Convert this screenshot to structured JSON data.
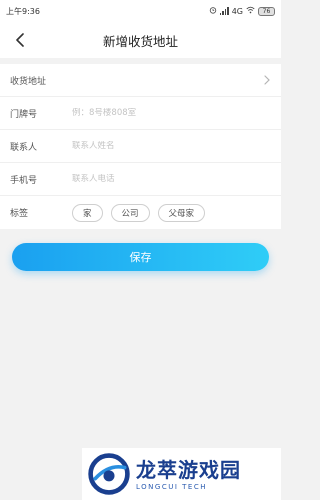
{
  "status_bar": {
    "time": "上午9:36",
    "network": "4G",
    "battery": "76"
  },
  "nav": {
    "title": "新增收货地址"
  },
  "form": {
    "address": {
      "label": "收货地址",
      "value": ""
    },
    "door": {
      "label": "门牌号",
      "placeholder": "例：8号楼808室"
    },
    "contact": {
      "label": "联系人",
      "placeholder": "联系人姓名"
    },
    "phone": {
      "label": "手机号",
      "placeholder": "联系人电话"
    },
    "tags": {
      "label": "标签",
      "options": [
        "家",
        "公司",
        "父母家"
      ]
    }
  },
  "save_label": "保存",
  "watermark": {
    "brand_cn": "龙萃游戏园",
    "brand_en": "LONGCUI TECH"
  }
}
